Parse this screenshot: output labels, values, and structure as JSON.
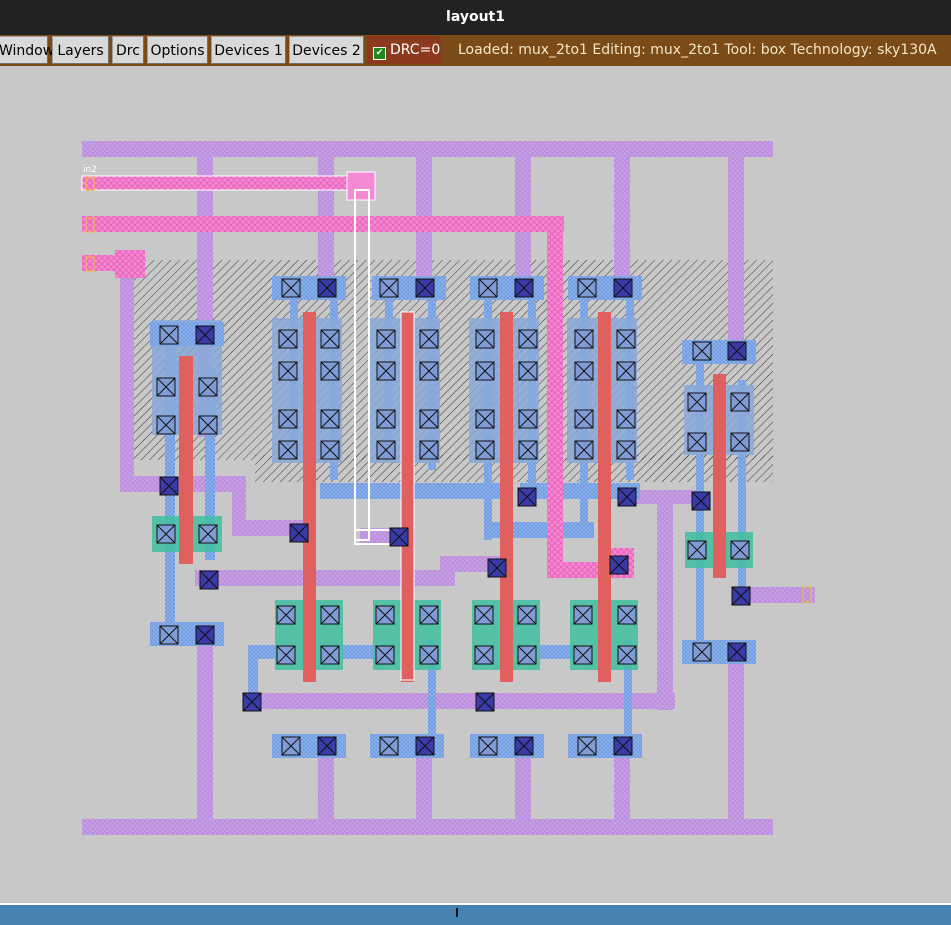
{
  "window": {
    "title": "layout1"
  },
  "menu": {
    "items": [
      "Window",
      "Layers",
      "Drc",
      "Options",
      "Devices 1",
      "Devices 2"
    ],
    "drc_label": "DRC=0",
    "drc_checked": true
  },
  "status": {
    "text": "Loaded: mux_2to1 Editing: mux_2to1 Tool: box  Technology: sky130A"
  },
  "layout": {
    "cell": "mux_2to1",
    "label_in2": "in2",
    "colors": {
      "background": "#c8c8c8",
      "metal1": "#c8a0e6",
      "locali": "#8fb6f0",
      "poly": "#e06060",
      "diff": "#3fbfa0",
      "nwell_hatch": "#202020",
      "metal2": "#f58ad4",
      "contact": "#1a1a8a",
      "label": "#f0c020"
    }
  }
}
